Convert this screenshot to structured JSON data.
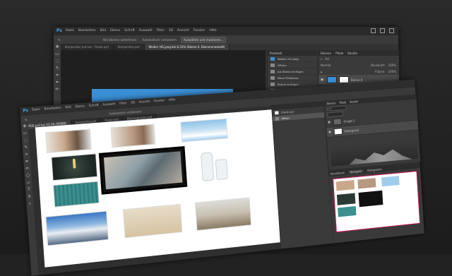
{
  "colors": {
    "accent": "#4ba3e3",
    "selection": "#4c6a8a",
    "canvas_blue": "#3a8fd6",
    "bg": "#222222"
  },
  "app_logo": "Ps",
  "menu": [
    "Datei",
    "Bearbeiten",
    "Bild",
    "Ebene",
    "Schrift",
    "Auswahl",
    "Filter",
    "3D",
    "Ansicht",
    "Fenster",
    "Hilfe"
  ],
  "options": {
    "sample_all": "Alle Ebenen aufnehmen",
    "auto_enhance": "Automatisch verbessern",
    "refine": "Auswählen und maskieren..."
  },
  "back_tabs": [
    "Kompositor Juornal - Finale.psd",
    "Kompositor.psd",
    "Weiber HG.jpeg bei 8,33% (Ebene 0, Ebenenmaske/8)"
  ],
  "history": {
    "title": "Protokoll",
    "snapshot": "Weiber HG.jpeg",
    "items": [
      "Öffnen",
      "Als Ebene einfügen",
      "Neue Füllebene",
      "Ebene einfügen",
      "Schnellauswahl",
      "Schnellauswahl",
      "Ebenenmaske hinzufügen"
    ]
  },
  "layers": {
    "tabs": [
      "Ebenen",
      "Pfade",
      "Kanäle"
    ],
    "kind": "Art",
    "blend": "Normal",
    "opacity_label": "Deckkraft:",
    "opacity": "100%",
    "fill_label": "Fläche:",
    "fill": "100%",
    "rows": [
      {
        "name": "Ebene 0"
      },
      {
        "name": "Farbfläche 1"
      }
    ]
  },
  "front": {
    "tab": "STAGE.psd bei 33,3% (RGB/8)",
    "tabs_right": [
      "Kompositor.psd",
      "Finale.psd",
      "Ebenengruppe.psd"
    ],
    "history_snapshot": "STAGE.psd",
    "history_item": "Öffnen",
    "layers_tabs": [
      "Ebenen",
      "Pfade",
      "Kanäle"
    ],
    "layer_rows": [
      {
        "name": "Gruppe 1"
      },
      {
        "name": "Hintergrund"
      }
    ],
    "bottom_tabs": [
      "Korrekturen",
      "Navigator",
      "Histogramm"
    ]
  },
  "photos": [
    {
      "name": "woman-lying-1"
    },
    {
      "name": "woman-lying-2"
    },
    {
      "name": "clouds"
    },
    {
      "name": "lightbulb"
    },
    {
      "name": "woman-framed"
    },
    {
      "name": "glass-bottles"
    },
    {
      "name": "teal-wood"
    },
    {
      "name": "mountain"
    },
    {
      "name": "sand-birds"
    },
    {
      "name": "stone-road"
    }
  ]
}
